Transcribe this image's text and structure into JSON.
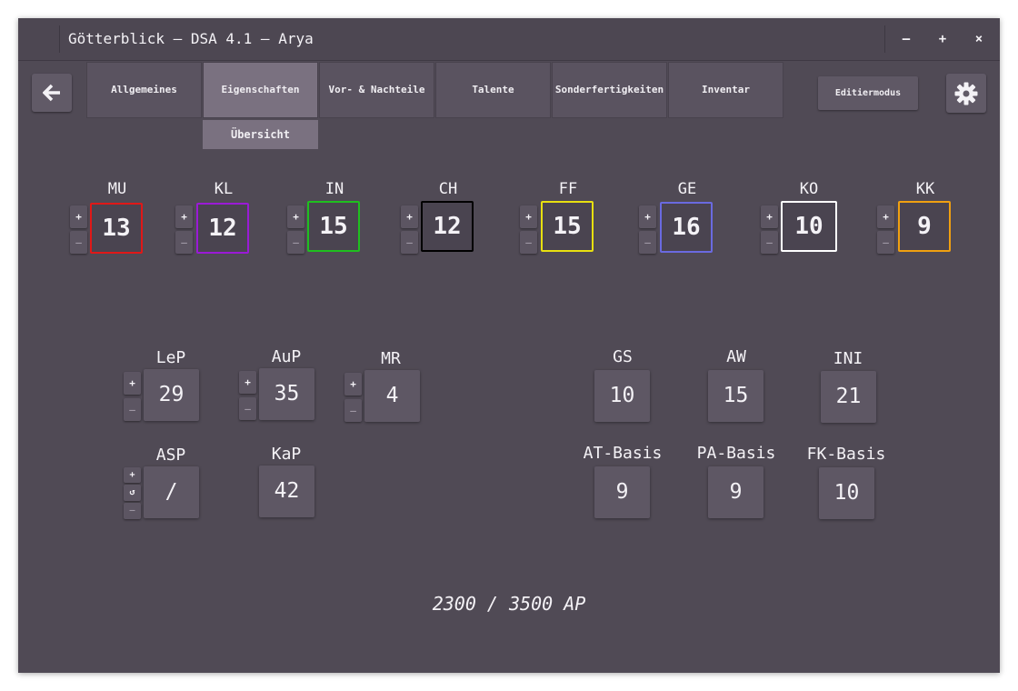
{
  "window": {
    "title": "Götterblick – DSA 4.1 – Arya",
    "minimize": "–",
    "maximize": "+",
    "close": "×"
  },
  "nav": {
    "tabs": [
      {
        "label": "Allgemeines"
      },
      {
        "label": "Eigenschaften"
      },
      {
        "label": "Vor- & Nachteile"
      },
      {
        "label": "Talente"
      },
      {
        "label": "Sonderfertigkeiten"
      },
      {
        "label": "Inventar"
      }
    ],
    "active_tab": "Eigenschaften",
    "subtab": "Übersicht",
    "edit_mode": "Editiermodus"
  },
  "attributes": [
    {
      "name": "MU",
      "value": "13",
      "color": "#e01818"
    },
    {
      "name": "KL",
      "value": "12",
      "color": "#9a1ad6"
    },
    {
      "name": "IN",
      "value": "15",
      "color": "#1fbf1f"
    },
    {
      "name": "CH",
      "value": "12",
      "color": "#000000"
    },
    {
      "name": "FF",
      "value": "15",
      "color": "#e8e010"
    },
    {
      "name": "GE",
      "value": "16",
      "color": "#6a6ae0"
    },
    {
      "name": "KO",
      "value": "10",
      "color": "#ffffff"
    },
    {
      "name": "KK",
      "value": "9",
      "color": "#f0a010"
    }
  ],
  "stats_left": [
    {
      "name": "LeP",
      "value": "29"
    },
    {
      "name": "AuP",
      "value": "35"
    },
    {
      "name": "MR",
      "value": "4"
    },
    {
      "name": "ASP",
      "value": "/"
    },
    {
      "name": "KaP",
      "value": "42"
    }
  ],
  "stats_right": [
    {
      "name": "GS",
      "value": "10"
    },
    {
      "name": "AW",
      "value": "15"
    },
    {
      "name": "INI",
      "value": "21"
    },
    {
      "name": "AT-Basis",
      "value": "9"
    },
    {
      "name": "PA-Basis",
      "value": "9"
    },
    {
      "name": "FK-Basis",
      "value": "10"
    }
  ],
  "controls": {
    "plus": "+",
    "minus": "–",
    "reset": "↺"
  },
  "ap": "2300 / 3500 AP"
}
